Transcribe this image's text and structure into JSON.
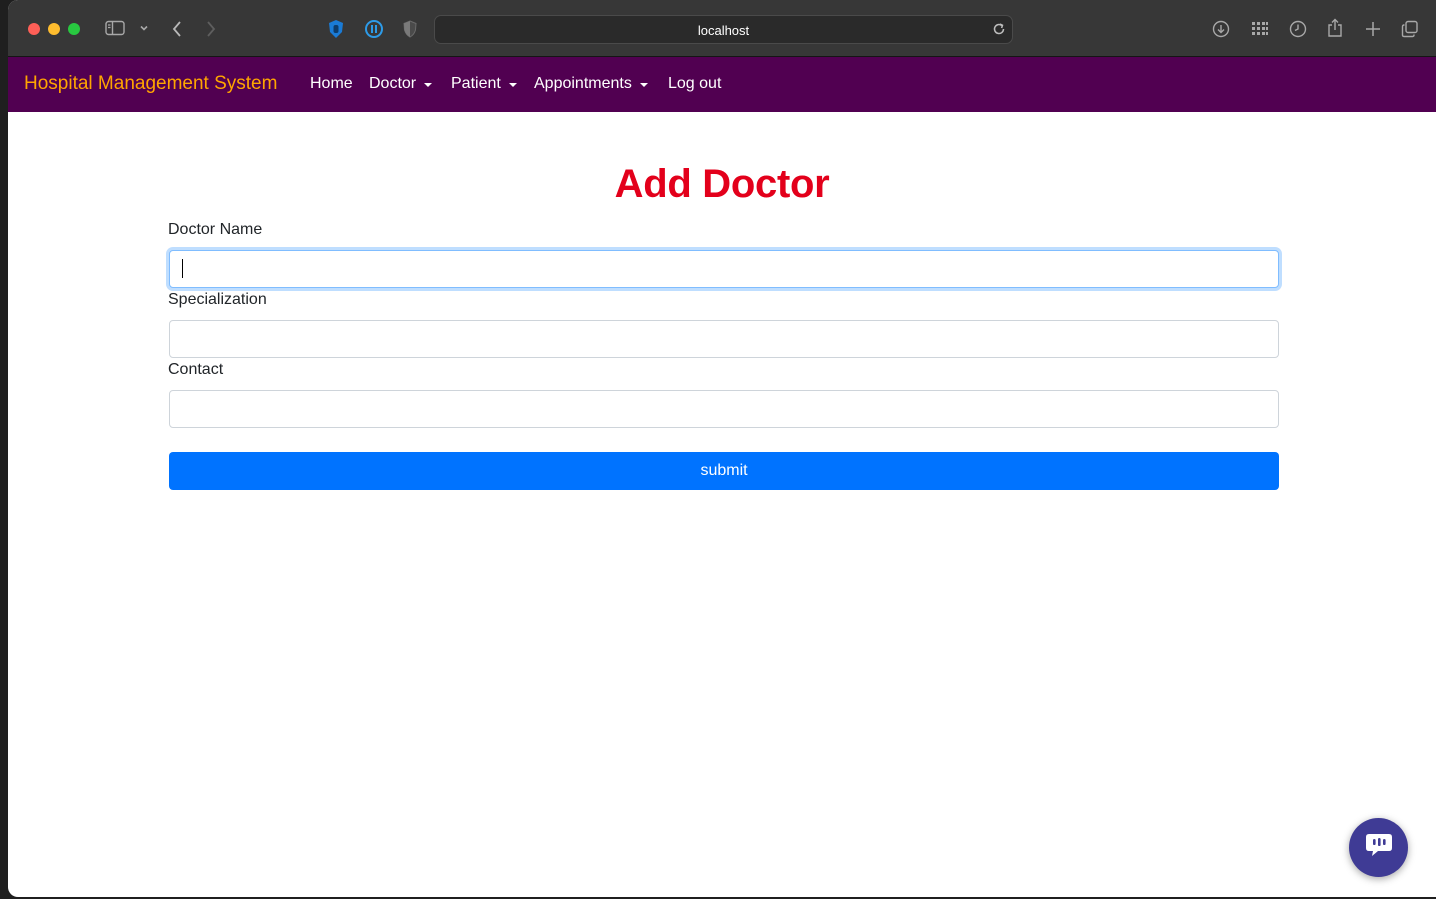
{
  "browser": {
    "url": "localhost"
  },
  "navbar": {
    "brand": "Hospital Management System",
    "items": [
      {
        "label": "Home"
      },
      {
        "label": "Doctor"
      },
      {
        "label": "Patient"
      },
      {
        "label": "Appointments"
      },
      {
        "label": "Log out"
      }
    ],
    "background_color": "#510051",
    "brand_color": "#ffa500"
  },
  "form": {
    "title": "Add Doctor",
    "title_color": "#e3001b",
    "fields": [
      {
        "label": "Doctor Name",
        "value": ""
      },
      {
        "label": "Specialization",
        "value": ""
      },
      {
        "label": "Contact",
        "value": ""
      }
    ],
    "submit_label": "submit",
    "submit_color": "#0073ff"
  },
  "icons": {
    "sidebar": "sidebar-icon",
    "back": "chevron-left-icon",
    "forward": "chevron-right-icon",
    "extension_1": "hand-stop-icon",
    "extension_2": "pause-icon",
    "extension_3": "shield-icon",
    "reload": "reload-icon",
    "downloads": "download-icon",
    "grid": "grid-icon",
    "history": "clock-icon",
    "share": "share-icon",
    "new_tab": "plus-icon",
    "tabs": "tabs-overview-icon",
    "chat": "chat-icon"
  }
}
